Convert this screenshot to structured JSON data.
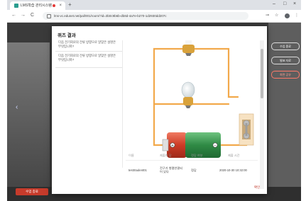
{
  "browser": {
    "tab_title": "LMS학습 관리시스템",
    "new_tab": "+",
    "tab_close": "×",
    "url": "lms-vc.edunet.net/pal/001/room/?id=3b0c9b6b-db8d-4a7e-b270-1d2930dd207c",
    "window_controls": [
      "–",
      "□",
      "×"
    ],
    "nav": [
      "←",
      "→",
      "C"
    ]
  },
  "app": {
    "right_buttons": [
      "수업 종료",
      "발표 자료",
      "화면 공유"
    ],
    "bottom_button": "수업 종료"
  },
  "modal": {
    "title": "퀴즈 결과",
    "questions": [
      "다음 전기회로의 전류 방향으로 알맞은 설명은 무엇입니까?",
      "다음 전기회로의 전류 방향으로 알맞은 설명은 무엇입니까?"
    ],
    "table": {
      "headers": [
        "이름",
        "제출한 답",
        "정답 여부",
        "제출 시간"
      ],
      "row": [
        "testStudent01",
        "전구가 병렬연결되어 있다",
        "정답",
        "2020-10-30 10:32:00"
      ]
    },
    "confirm": "확인"
  },
  "colors": {
    "modal_bg": "#ffffff",
    "wire": "#f2a94b",
    "battery_green": "#3a9a52",
    "battery_red": "#d8432f",
    "confirm": "#c0392b"
  }
}
